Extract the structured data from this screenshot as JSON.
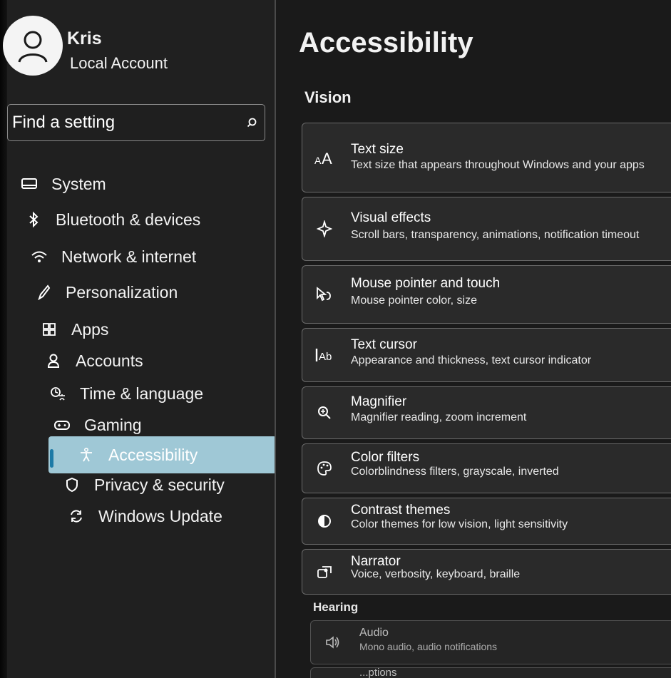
{
  "user": {
    "name": "Kris",
    "account_type": "Local Account"
  },
  "search": {
    "placeholder": "Find a setting"
  },
  "nav": {
    "items": [
      {
        "label": "System"
      },
      {
        "label": "Bluetooth & devices"
      },
      {
        "label": "Network & internet"
      },
      {
        "label": "Personalization"
      },
      {
        "label": "Apps"
      },
      {
        "label": "Accounts"
      },
      {
        "label": "Time & language"
      },
      {
        "label": "Gaming"
      },
      {
        "label": "Accessibility"
      },
      {
        "label": "Privacy & security"
      },
      {
        "label": "Windows Update"
      }
    ],
    "selected": "Accessibility"
  },
  "main": {
    "title": "Accessibility",
    "sections": {
      "vision": "Vision",
      "hearing": "Hearing"
    },
    "cards": [
      {
        "title": "Text size",
        "subtitle": "Text size that appears throughout Windows and your apps",
        "icon": "text-size-icon"
      },
      {
        "title": "Visual effects",
        "subtitle": "Scroll bars, transparency, animations, notification timeout",
        "icon": "visual-effects-icon"
      },
      {
        "title": "Mouse pointer and touch",
        "subtitle": "Mouse pointer color, size",
        "icon": "mouse-pointer-icon"
      },
      {
        "title": "Text cursor",
        "subtitle": "Appearance and thickness, text cursor indicator",
        "icon": "text-cursor-icon"
      },
      {
        "title": "Magnifier",
        "subtitle": "Magnifier reading, zoom increment",
        "icon": "magnifier-icon"
      },
      {
        "title": "Color filters",
        "subtitle": "Colorblindness filters, grayscale, inverted",
        "icon": "color-filters-icon"
      },
      {
        "title": "Contrast themes",
        "subtitle": "Color themes for low vision, light sensitivity",
        "icon": "contrast-themes-icon"
      },
      {
        "title": "Narrator",
        "subtitle": "Voice, verbosity, keyboard, braille",
        "icon": "narrator-icon"
      },
      {
        "title": "Audio",
        "subtitle": "Mono audio, audio notifications",
        "icon": "audio-icon"
      },
      {
        "title": "...ptions",
        "subtitle": "",
        "icon": ""
      }
    ]
  },
  "colors": {
    "accent": "#1d7aa6",
    "selected_bg": "#9fc8d6",
    "card_bg": "#2a2a2a",
    "sidebar_bg": "#202020"
  }
}
